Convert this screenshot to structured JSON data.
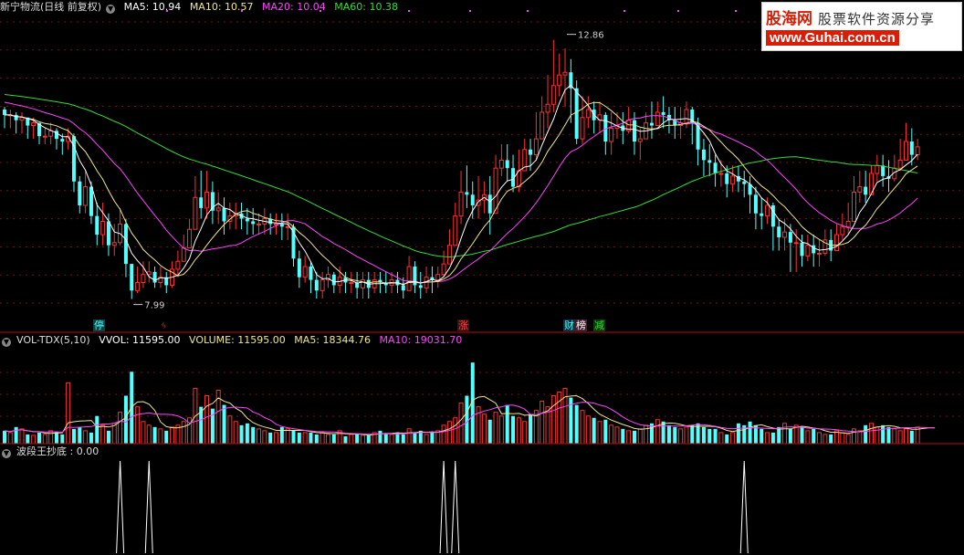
{
  "window_title": "新宁物流(日线 前复权)",
  "ma_legend": [
    {
      "label": "MA5: 10.94",
      "color": "#ffffff"
    },
    {
      "label": "MA10: 10.57",
      "color": "#f0e68c"
    },
    {
      "label": "MA20: 10.04",
      "color": "#ff44ff"
    },
    {
      "label": "MA60: 10.38",
      "color": "#33dd33"
    }
  ],
  "vol_legend": [
    {
      "label": "VOL-TDX(5,10)",
      "color": "#dddddd"
    },
    {
      "label": "VVOL: 11595.00",
      "color": "#ffffff"
    },
    {
      "label": "VOLUME: 11595.00",
      "color": "#f0e68c"
    },
    {
      "label": "MA5: 18344.76",
      "color": "#f0e68c"
    },
    {
      "label": "MA10: 19031.70",
      "color": "#ff44ff"
    }
  ],
  "indicator_legend": [
    {
      "label": "波段王抄底 : 0.00",
      "color": "#dddddd"
    }
  ],
  "watermark": {
    "brand": "股海网",
    "slogan": "股票软件资源分享",
    "url": "www.Guhai.com.cn"
  },
  "events": [
    {
      "label": "停",
      "color": "#44ffff",
      "bg": "#124040"
    },
    {
      "label": "ᛃ",
      "color": "#ff4444",
      "bg": "#000000"
    },
    {
      "label": "涨",
      "color": "#ff4444",
      "bg": "#401010"
    },
    {
      "label": "财",
      "color": "#44ffff",
      "bg": "#123040"
    },
    {
      "label": "榜",
      "color": "#ffffff",
      "bg": "#402030"
    },
    {
      "label": "减",
      "color": "#33dd33",
      "bg": "#103810"
    }
  ],
  "chart_data": [
    {
      "type": "candlestick",
      "title": "新宁物流(日线 前复权)",
      "ylim": [
        7.4,
        13.3
      ],
      "price_labels": [
        "12.86",
        "7.99"
      ],
      "price_annotations": [
        {
          "label": "12.86",
          "value": 12.86,
          "index": 97
        },
        {
          "label": "7.99",
          "value": 7.99,
          "index": 22
        }
      ],
      "grid": true,
      "colors": {
        "up": "#ff3030",
        "down": "#54ffff",
        "ma5": "#ffffff",
        "ma10": "#f0e68c",
        "ma20": "#ff44ff",
        "ma60": "#33dd33"
      },
      "close": [
        11.45,
        11.45,
        11.35,
        11.4,
        11.25,
        11.3,
        11.05,
        11.05,
        11.15,
        11.0,
        10.95,
        11.05,
        10.2,
        9.75,
        10.1,
        9.55,
        9.2,
        9.45,
        9.0,
        9.05,
        9.4,
        8.65,
        8.15,
        8.3,
        8.45,
        8.5,
        8.3,
        8.4,
        8.25,
        8.55,
        8.7,
        8.95,
        9.3,
        9.9,
        9.7,
        10.0,
        9.65,
        9.7,
        9.45,
        9.55,
        9.6,
        9.5,
        9.45,
        9.4,
        9.4,
        9.5,
        9.4,
        9.4,
        9.35,
        9.35,
        8.75,
        8.4,
        8.6,
        8.35,
        8.15,
        8.35,
        8.45,
        8.25,
        8.4,
        8.3,
        8.3,
        8.2,
        8.35,
        8.2,
        8.35,
        8.3,
        8.25,
        8.35,
        8.25,
        8.15,
        8.6,
        8.25,
        8.2,
        8.4,
        8.35,
        8.45,
        8.65,
        9.0,
        9.55,
        10.0,
        9.95,
        9.75,
        9.85,
        9.95,
        9.6,
        10.45,
        10.6,
        10.45,
        10.1,
        10.4,
        10.8,
        10.7,
        11.0,
        11.5,
        11.65,
        12.0,
        12.2,
        12.25,
        11.95,
        11.0,
        11.4,
        11.55,
        11.35,
        11.45,
        10.95,
        11.2,
        11.25,
        11.15,
        11.35,
        10.95,
        11.0,
        11.3,
        11.25,
        11.5,
        11.45,
        11.35,
        11.25,
        11.3,
        11.55,
        11.3,
        10.8,
        10.6,
        10.55,
        10.35,
        10.35,
        10.15,
        10.3,
        10.2,
        10.15,
        9.95,
        9.6,
        9.55,
        9.75,
        9.35,
        9.15,
        9.25,
        9.05,
        9.05,
        8.8,
        9.0,
        8.85,
        8.85,
        9.1,
        8.9,
        9.2,
        9.35,
        9.45,
        10.0,
        10.1,
        9.95,
        10.35,
        10.5,
        10.3,
        10.25,
        10.45,
        10.6,
        10.95,
        10.7,
        10.85
      ],
      "high": [
        11.6,
        11.55,
        11.5,
        11.5,
        11.4,
        11.4,
        11.3,
        11.2,
        11.3,
        11.2,
        11.1,
        11.2,
        11.1,
        10.3,
        10.4,
        10.2,
        9.8,
        9.8,
        9.6,
        9.4,
        9.7,
        9.5,
        8.6,
        8.6,
        8.7,
        8.7,
        8.6,
        8.6,
        8.5,
        8.7,
        8.9,
        9.2,
        9.5,
        10.3,
        10.4,
        10.4,
        10.2,
        10.0,
        9.9,
        9.8,
        9.8,
        9.8,
        9.7,
        9.7,
        9.6,
        9.7,
        9.6,
        9.6,
        9.6,
        9.6,
        9.4,
        8.9,
        8.8,
        8.7,
        8.5,
        8.5,
        8.6,
        8.5,
        8.6,
        8.5,
        8.5,
        8.5,
        8.5,
        8.5,
        8.5,
        8.5,
        8.5,
        8.5,
        8.5,
        8.4,
        8.8,
        8.7,
        8.5,
        8.6,
        8.6,
        8.6,
        8.9,
        9.3,
        9.8,
        10.4,
        10.5,
        10.2,
        10.3,
        10.2,
        10.3,
        10.7,
        10.9,
        10.9,
        10.7,
        10.8,
        11.0,
        11.0,
        11.5,
        11.8,
        12.2,
        12.86,
        12.6,
        12.7,
        12.5,
        12.1,
        11.8,
        11.8,
        11.7,
        11.7,
        11.5,
        11.5,
        11.5,
        11.5,
        11.6,
        11.5,
        11.2,
        11.5,
        11.7,
        11.7,
        11.8,
        11.6,
        11.6,
        11.6,
        11.7,
        11.6,
        11.4,
        11.0,
        10.9,
        10.7,
        10.6,
        10.5,
        10.5,
        10.5,
        10.4,
        10.3,
        10.1,
        9.9,
        9.9,
        9.8,
        9.5,
        9.5,
        9.4,
        9.3,
        9.2,
        9.2,
        9.2,
        9.1,
        9.3,
        9.3,
        9.4,
        9.6,
        9.8,
        10.3,
        10.4,
        10.4,
        10.5,
        10.7,
        10.7,
        10.6,
        10.7,
        11.0,
        11.3,
        11.2,
        11.0
      ],
      "low": [
        11.2,
        11.2,
        11.1,
        11.1,
        11.0,
        11.0,
        10.9,
        10.9,
        10.9,
        10.8,
        10.7,
        10.8,
        10.0,
        9.6,
        9.6,
        9.4,
        9.0,
        9.0,
        8.8,
        8.8,
        9.0,
        8.4,
        7.99,
        8.1,
        8.2,
        8.3,
        8.2,
        8.2,
        8.1,
        8.2,
        8.4,
        8.7,
        9.0,
        9.5,
        9.5,
        9.5,
        9.4,
        9.4,
        9.2,
        9.3,
        9.3,
        9.3,
        9.2,
        9.2,
        9.2,
        9.2,
        9.2,
        9.2,
        9.1,
        9.1,
        8.6,
        8.2,
        8.3,
        8.1,
        8.0,
        8.0,
        8.2,
        8.1,
        8.1,
        8.1,
        8.1,
        8.0,
        8.0,
        8.0,
        8.1,
        8.1,
        8.1,
        8.1,
        8.1,
        8.0,
        8.2,
        8.1,
        8.0,
        8.1,
        8.1,
        8.2,
        8.4,
        8.7,
        9.2,
        9.4,
        9.7,
        9.5,
        9.5,
        9.6,
        9.2,
        9.8,
        10.3,
        10.2,
        10.0,
        10.0,
        10.5,
        10.4,
        10.6,
        11.0,
        11.2,
        11.5,
        11.8,
        11.6,
        11.3,
        10.9,
        10.9,
        11.2,
        11.1,
        11.1,
        10.7,
        10.7,
        11.0,
        10.9,
        11.1,
        10.7,
        10.6,
        11.0,
        11.0,
        11.3,
        11.2,
        11.1,
        11.0,
        11.0,
        11.2,
        10.9,
        10.5,
        10.3,
        10.3,
        10.1,
        10.1,
        9.9,
        10.0,
        10.0,
        9.9,
        9.6,
        9.3,
        9.3,
        9.4,
        8.9,
        8.9,
        8.9,
        8.5,
        8.5,
        8.6,
        8.7,
        8.6,
        8.6,
        8.8,
        8.7,
        8.9,
        9.1,
        9.2,
        9.7,
        9.8,
        9.8,
        10.1,
        10.2,
        10.1,
        10.0,
        10.2,
        10.4,
        10.6,
        10.5,
        10.6
      ]
    },
    {
      "type": "bar",
      "title": "VOL-TDX(5,10)",
      "ylim": [
        0,
        105000
      ],
      "values": [
        14000,
        12000,
        18000,
        16000,
        10000,
        9000,
        12000,
        10000,
        14000,
        13000,
        10000,
        66000,
        16000,
        18000,
        14000,
        12000,
        30000,
        20000,
        14000,
        22000,
        34000,
        52000,
        78000,
        40000,
        24000,
        20000,
        18000,
        16000,
        14000,
        18000,
        20000,
        24000,
        28000,
        60000,
        40000,
        52000,
        38000,
        58000,
        42000,
        30000,
        24000,
        20000,
        22000,
        18000,
        16000,
        14000,
        12000,
        12000,
        18000,
        16000,
        14000,
        12000,
        12000,
        12000,
        10000,
        12000,
        10000,
        10000,
        14000,
        8000,
        10000,
        10000,
        9000,
        9000,
        12000,
        14000,
        11000,
        10000,
        12000,
        10000,
        16000,
        12000,
        14000,
        10000,
        12000,
        14000,
        20000,
        24000,
        28000,
        44000,
        52000,
        88000,
        40000,
        32000,
        26000,
        34000,
        30000,
        42000,
        30000,
        28000,
        24000,
        32000,
        36000,
        46000,
        40000,
        52000,
        56000,
        60000,
        50000,
        42000,
        36000,
        30000,
        28000,
        24000,
        26000,
        20000,
        18000,
        16000,
        14000,
        14000,
        16000,
        20000,
        22000,
        26000,
        24000,
        20000,
        18000,
        16000,
        18000,
        20000,
        22000,
        18000,
        16000,
        16000,
        12000,
        10000,
        12000,
        22000,
        20000,
        24000,
        20000,
        16000,
        12000,
        12000,
        18000,
        22000,
        16000,
        20000,
        18000,
        14000,
        16000,
        12000,
        10000,
        10000,
        14000,
        12000,
        10000,
        16000,
        14000,
        20000,
        22000,
        18000,
        20000,
        18000,
        16000,
        14000,
        16000,
        14000,
        18000,
        20000,
        18000,
        16000
      ]
    },
    {
      "type": "line",
      "title": "波段王抄底",
      "ylim": [
        0,
        1
      ],
      "signal_indices": [
        20,
        25,
        76,
        78,
        128
      ]
    }
  ]
}
